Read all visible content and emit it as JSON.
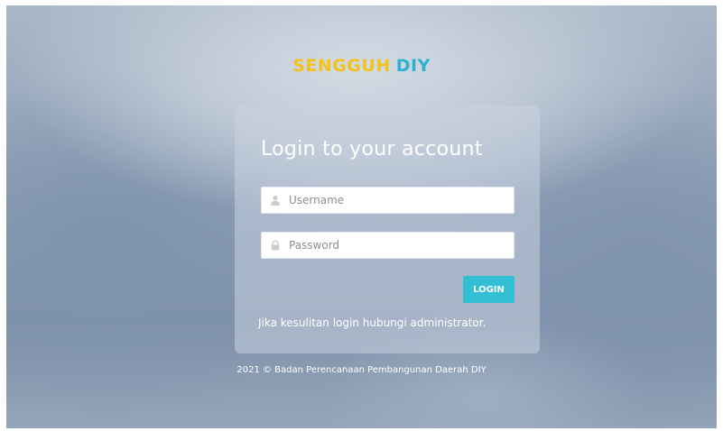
{
  "brand": {
    "part1": "SENGGUH",
    "part2": "DIY"
  },
  "login_card": {
    "title": "Login to your account",
    "username": {
      "placeholder": "Username",
      "value": "",
      "icon": "user-icon"
    },
    "password": {
      "placeholder": "Password",
      "value": "",
      "icon": "lock-icon"
    },
    "login_label": "LOGIN",
    "help_text": "Jika kesulitan login hubungi administrator."
  },
  "footer": {
    "text": "2021 © Badan Perencanaan Pembangunan Daerah DIY"
  },
  "colors": {
    "brand_yellow": "#f4c21b",
    "brand_blue": "#2fb0cf",
    "button": "#33bfd3"
  }
}
